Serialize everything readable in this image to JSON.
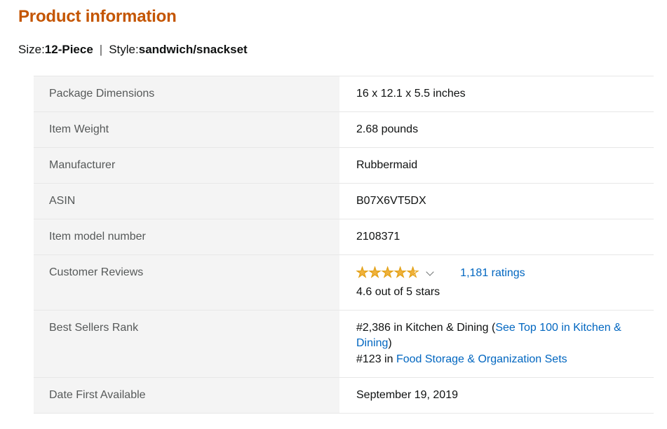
{
  "header": {
    "title": "Product information",
    "variant": {
      "size_label": "Size:",
      "size_value": "12-Piece",
      "separator": "|",
      "style_label": "Style:",
      "style_value": "sandwich/snackset"
    }
  },
  "table": {
    "rows": [
      {
        "label": "Package Dimensions",
        "value": "16 x 12.1 x 5.5 inches"
      },
      {
        "label": "Item Weight",
        "value": "2.68 pounds"
      },
      {
        "label": "Manufacturer",
        "value": "Rubbermaid"
      },
      {
        "label": "ASIN",
        "value": "B07X6VT5DX"
      },
      {
        "label": "Item model number",
        "value": "2108371"
      },
      {
        "label": "Customer Reviews",
        "value": ""
      },
      {
        "label": "Best Sellers Rank",
        "value": ""
      },
      {
        "label": "Date First Available",
        "value": "September 19, 2019"
      }
    ]
  },
  "reviews": {
    "label": "Customer Reviews",
    "rating": 4.6,
    "rating_percent": "92%",
    "stars_text": "★★★★★",
    "ratings_count_link": "1,181 ratings",
    "caption": "4.6 out of 5 stars",
    "star_color": "#F0B23C",
    "link_color": "#0066c0"
  },
  "best_sellers_rank": {
    "label": "Best Sellers Rank",
    "line1_prefix": "#2,386 in Kitchen & Dining (",
    "line1_link": "See Top 100 in Kitchen & Dining",
    "line1_suffix": ")",
    "line2_prefix": "#123 in ",
    "line2_link": "Food Storage & Organization Sets"
  },
  "date_first_available": {
    "label": "Date First Available",
    "value": "September 19, 2019"
  }
}
